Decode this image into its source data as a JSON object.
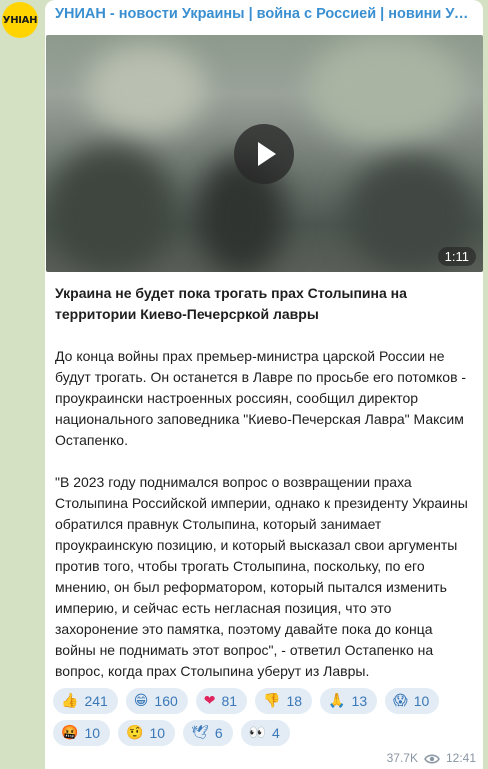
{
  "channel": {
    "title": "УНИАН - новости Украины | война с Россией | новини Україн...",
    "avatar_text": "УНІАН",
    "avatar_color": "#ffd400"
  },
  "video": {
    "duration": "1:11",
    "icon": "play-icon"
  },
  "post": {
    "headline": "Украина не будет пока трогать прах Столыпина на территории Киево-Печерсркой лавры",
    "paragraph1": "До конца войны прах премьер-министра царской России не будут трогать. Он останется в Лавре по просьбе его потомков - проукраински настроенных россиян, сообщил директор национального заповедника \"Киево-Печерская Лавра\" Максим Остапенко.",
    "paragraph2": "\"В 2023 году поднимался вопрос о возвращении праха Столыпина Российской империи, однако к президенту Украины обратился правнук Столыпина, который занимает проукраинскую позицию, и который высказал свои аргументы против того, чтобы трогать Столыпина, поскольку, по его мнению, он был реформатором, который пытался изменить империю, и сейчас есть негласная позиция, что это захоронение это памятка, поэтому давайте пока до конца войны не поднимать этот вопрос\", - ответил Остапенко на вопрос, когда прах Столыпина уберут из Лавры."
  },
  "reactions": [
    {
      "emoji": "👍",
      "count": "241",
      "icon": "thumbs-up-icon"
    },
    {
      "emoji": "😁",
      "count": "160",
      "icon": "grin-icon"
    },
    {
      "emoji": "❤",
      "count": "81",
      "icon": "heart-icon"
    },
    {
      "emoji": "👎",
      "count": "18",
      "icon": "thumbs-down-icon"
    },
    {
      "emoji": "🙏",
      "count": "13",
      "icon": "pray-icon"
    },
    {
      "emoji": "😱",
      "count": "10",
      "icon": "scream-icon"
    },
    {
      "emoji": "🤬",
      "count": "10",
      "icon": "cursing-icon"
    },
    {
      "emoji": "🤨",
      "count": "10",
      "icon": "raised-eyebrow-icon"
    },
    {
      "emoji": "🕊",
      "count": "6",
      "icon": "dove-icon"
    },
    {
      "emoji": "👀",
      "count": "4",
      "icon": "eyes-icon"
    }
  ],
  "footer": {
    "views": "37.7K",
    "time": "12:41",
    "views_icon": "eye-icon"
  },
  "colors": {
    "background": "#d4e1c2",
    "title": "#3a8fd0",
    "reaction_bg": "#e3ecf5",
    "reaction_text": "#3a78b8"
  }
}
